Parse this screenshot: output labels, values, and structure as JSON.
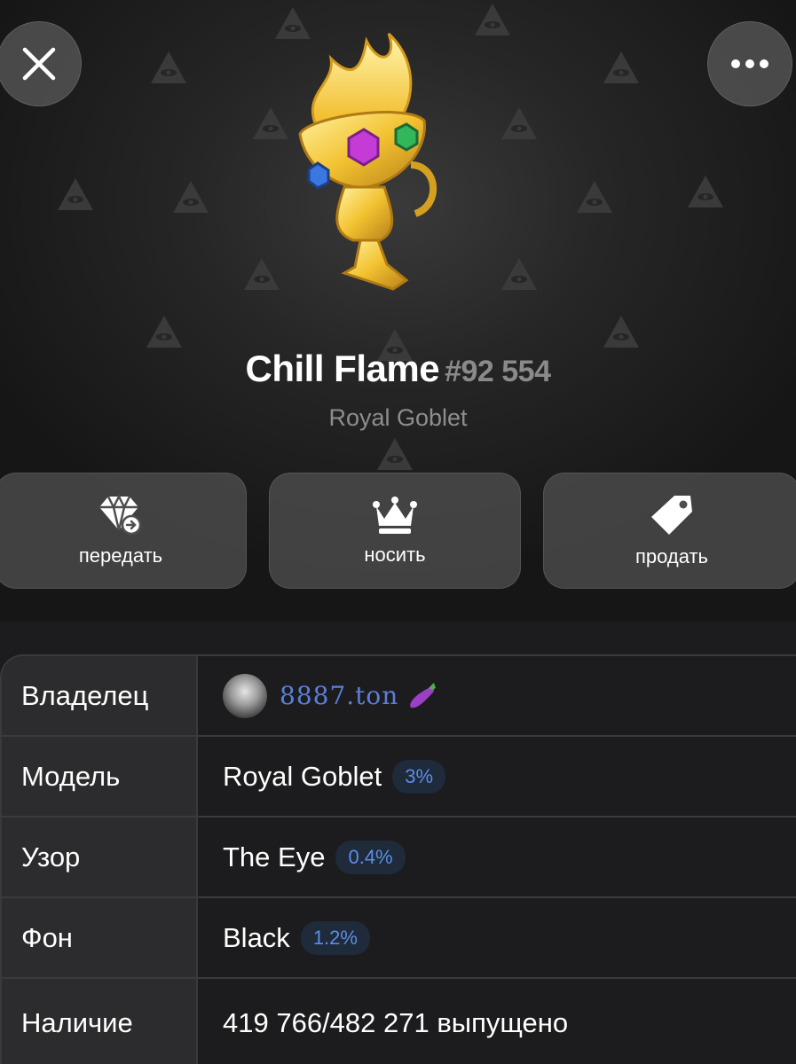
{
  "header": {
    "close_icon": "close-icon",
    "more_icon": "more-dots-icon"
  },
  "gift": {
    "name": "Chill Flame",
    "number": "#92 554",
    "collection": "Royal Goblet",
    "pattern_icon": "eye-pyramid-icon"
  },
  "actions": [
    {
      "label": "передать",
      "icon": "diamond-transfer-icon"
    },
    {
      "label": "носить",
      "icon": "crown-icon"
    },
    {
      "label": "продать",
      "icon": "tag-icon"
    }
  ],
  "details": {
    "owner": {
      "key": "Владелец",
      "value": "8887.ton"
    },
    "model": {
      "key": "Модель",
      "value": "Royal Goblet",
      "badge": "3%"
    },
    "pattern": {
      "key": "Узор",
      "value": "The Eye",
      "badge": "0.4%"
    },
    "backdrop": {
      "key": "Фон",
      "value": "Black",
      "badge": "1.2%"
    },
    "availability": {
      "key": "Наличие",
      "value": "419 766/482 271 выпущено"
    }
  },
  "colors": {
    "accent": "#5b8ee6",
    "badge_bg": "#1f2a3a",
    "gold": "#f2c230"
  }
}
